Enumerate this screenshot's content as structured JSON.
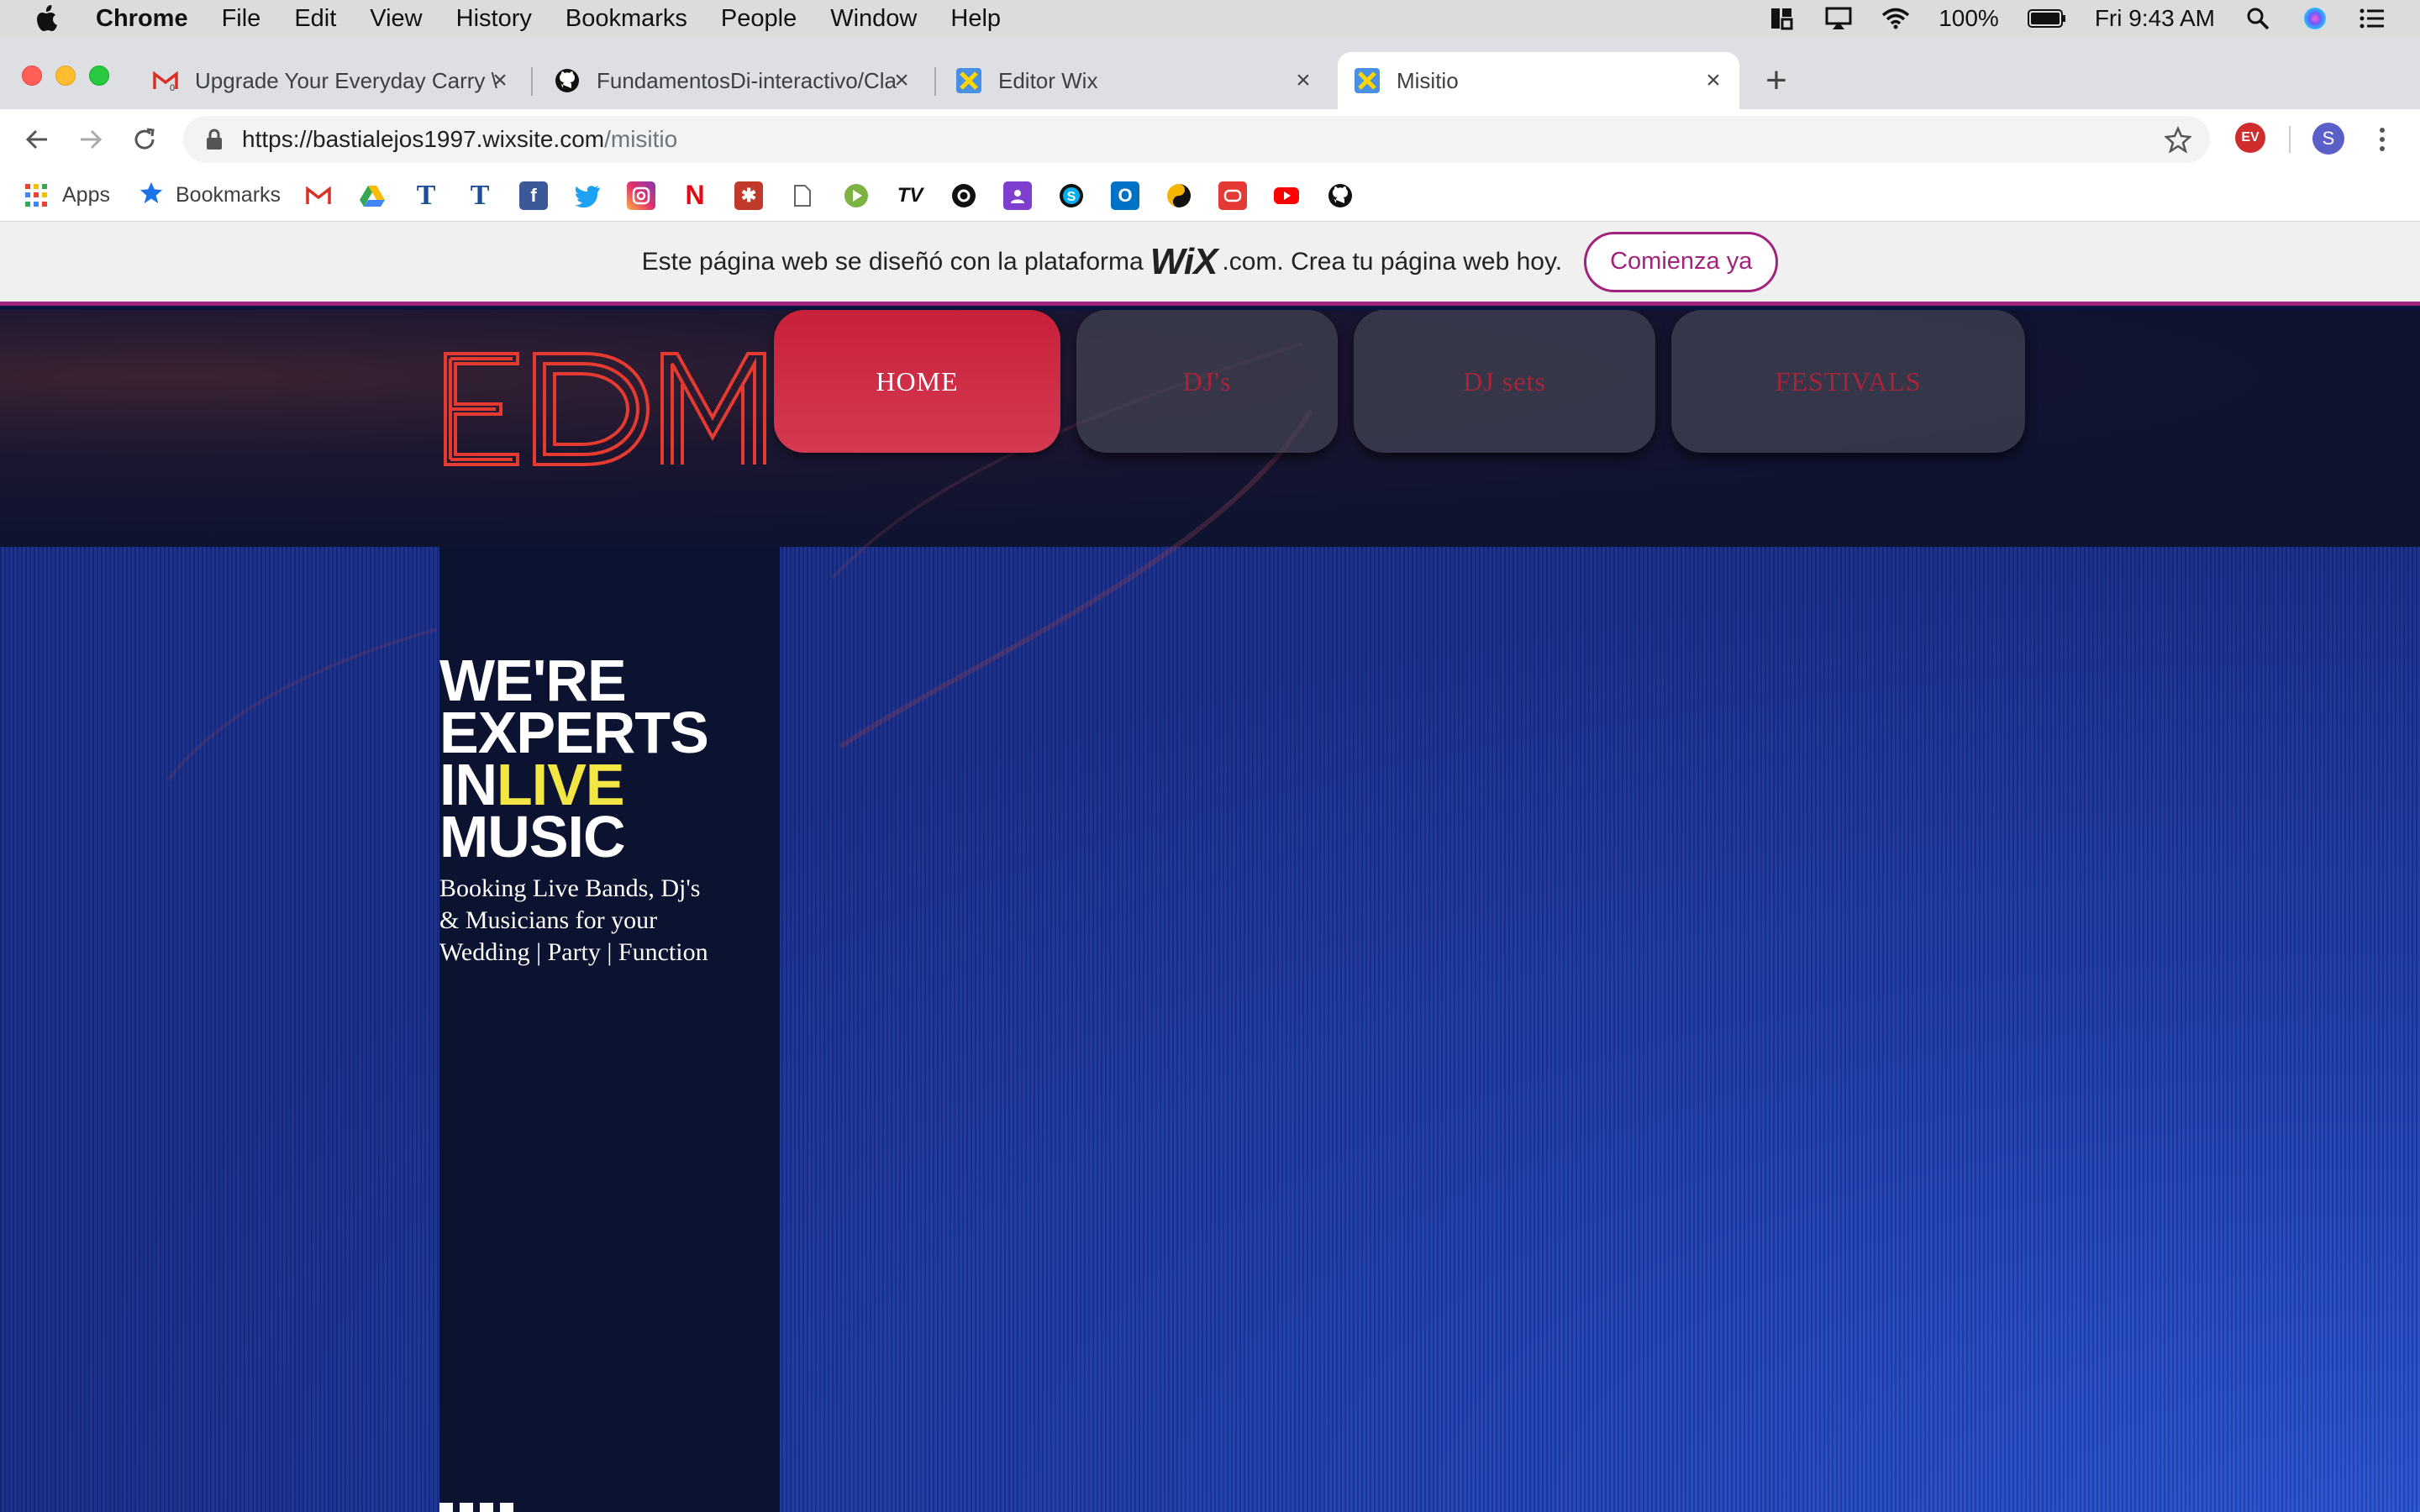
{
  "menubar": {
    "app_name": "Chrome",
    "items": [
      "File",
      "Edit",
      "View",
      "History",
      "Bookmarks",
      "People",
      "Window",
      "Help"
    ],
    "battery": "100%",
    "clock": "Fri 9:43 AM"
  },
  "tabs": [
    {
      "title": "Upgrade Your Everyday Carry \\",
      "icon": "gmail-icon"
    },
    {
      "title": "FundamentosDi-interactivo/Cla",
      "icon": "github-icon"
    },
    {
      "title": "Editor Wix",
      "icon": "wix-icon"
    },
    {
      "title": "Misitio",
      "icon": "wix-icon",
      "active": true
    }
  ],
  "address_bar": {
    "host": "https://bastialejos1997.wixsite.com",
    "path": "/misitio"
  },
  "profile": {
    "initial": "S"
  },
  "extension": {
    "label": "EV"
  },
  "bookmarks_bar": {
    "apps_label": "Apps",
    "bookmarks_label": "Bookmarks"
  },
  "wix_banner": {
    "text_before": "Este página web se diseñó con la plataforma",
    "logo": "WiX",
    "text_after": ".com. Crea tu página web hoy.",
    "cta": "Comienza ya"
  },
  "site": {
    "logo_text": "EDM",
    "nav": [
      "HOME",
      "DJ's",
      "DJ sets",
      "FESTIVALS"
    ],
    "headline": {
      "line1": "WE'RE",
      "line2": "EXPERTS",
      "line3_prefix": "IN",
      "line3_highlight": "LIVE",
      "line4": "MUSIC"
    },
    "subtext_lines": [
      "Booking Live Bands, Dj's",
      "& Musicians for your",
      "Wedding | Party | Function"
    ]
  },
  "colors": {
    "accent_red": "#c8203a",
    "highlight_yellow": "#f3e543",
    "wix_purple": "#a1237d",
    "hero_blue": "#1f3fb0"
  }
}
